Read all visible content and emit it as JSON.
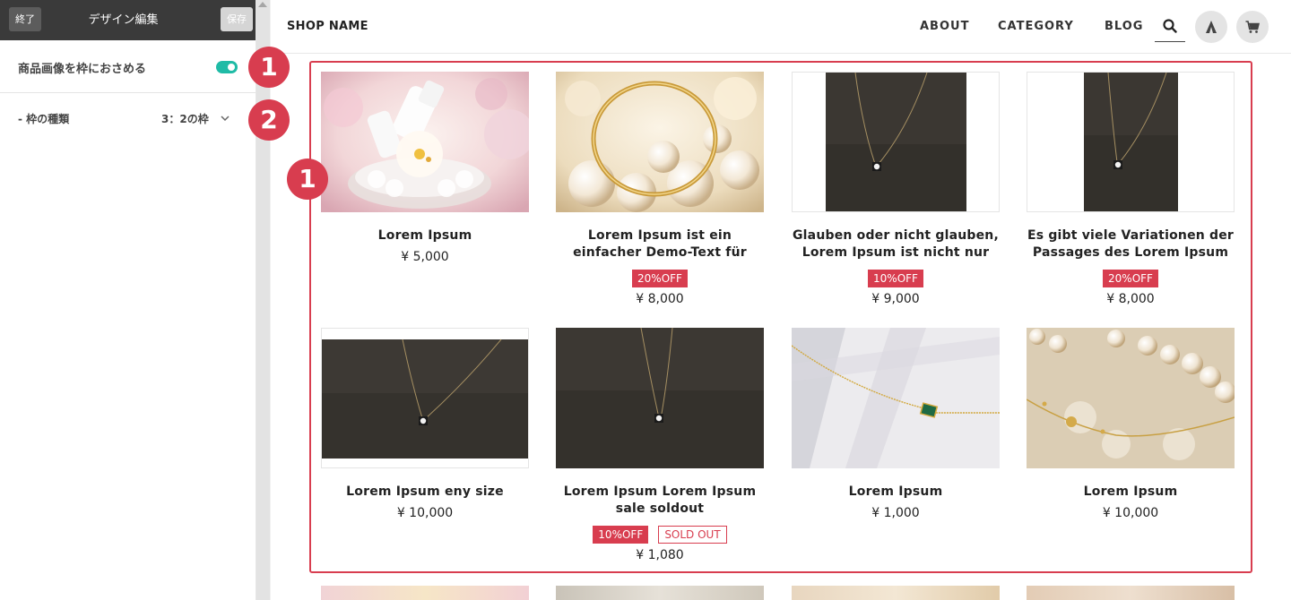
{
  "panel": {
    "end_label": "終了",
    "title": "デザイン編集",
    "save_label": "保存",
    "fit_image_label": "商品画像を枠におさめる",
    "fit_image_enabled": true,
    "frame_type_label": "- 枠の種類",
    "frame_type_value": "3：2の枠"
  },
  "markers": {
    "m1": "1",
    "m2": "2",
    "m3": "1"
  },
  "header": {
    "shop_name": "SHOP NAME",
    "nav": [
      "ABOUT",
      "CATEGORY",
      "BLOG"
    ],
    "icons": [
      "search-icon",
      "tent-icon",
      "cart-icon"
    ]
  },
  "products": [
    {
      "name_lines": [
        "Lorem Ipsum"
      ],
      "badges": [],
      "price": "¥ 5,000",
      "image": "cosmetics-flowers"
    },
    {
      "name_lines": [
        "Lorem Ipsum ist ein",
        "einfacher Demo-Text für"
      ],
      "badges": [
        "20%OFF"
      ],
      "price": "¥ 8,000",
      "image": "gold-ring-pearls"
    },
    {
      "name_lines": [
        "Glauben oder nicht glauben,",
        "Lorem Ipsum ist nicht nur"
      ],
      "badges": [
        "10%OFF"
      ],
      "price": "¥ 9,000",
      "image": "necklace-portrait"
    },
    {
      "name_lines": [
        "Es gibt viele Variationen der",
        "Passages des Lorem Ipsum"
      ],
      "badges": [
        "20%OFF"
      ],
      "price": "¥ 8,000",
      "image": "necklace-portrait"
    },
    {
      "name_lines": [
        "Lorem Ipsum eny size"
      ],
      "badges": [],
      "price": "¥ 10,000",
      "image": "necklace-wide"
    },
    {
      "name_lines": [
        "Lorem Ipsum Lorem Ipsum",
        "sale soldout"
      ],
      "badges": [
        "10%OFF"
      ],
      "sold_out": "SOLD OUT",
      "price": "¥ 1,080",
      "image": "necklace-dark"
    },
    {
      "name_lines": [
        "Lorem Ipsum"
      ],
      "badges": [],
      "price": "¥ 1,000",
      "image": "emerald-necklace"
    },
    {
      "name_lines": [
        "Lorem Ipsum"
      ],
      "badges": [],
      "price": "¥ 10,000",
      "image": "pearls-lace"
    }
  ],
  "colors": {
    "accent": "#d83d4f",
    "toggle": "#1fbba6",
    "panel_header": "#3a3a3a"
  }
}
